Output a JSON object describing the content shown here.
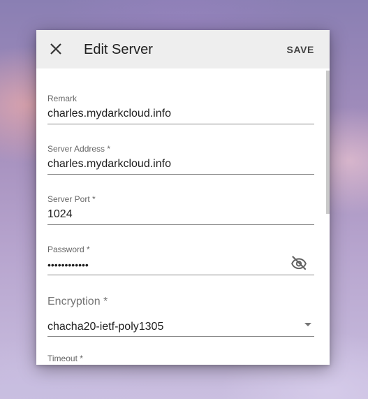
{
  "dialog": {
    "title": "Edit Server",
    "close_icon": "close-icon",
    "save_label": "SAVE"
  },
  "fields": {
    "remark": {
      "label": "Remark",
      "value": "charles.mydarkcloud.info"
    },
    "server_address": {
      "label": "Server Address *",
      "value": "charles.mydarkcloud.info"
    },
    "server_port": {
      "label": "Server Port *",
      "value": "1024"
    },
    "password": {
      "label": "Password *",
      "value": "••••••••••••",
      "toggle_icon": "visibility-off-icon"
    },
    "encryption": {
      "label": "Encryption *",
      "value": "chacha20-ietf-poly1305",
      "dropdown_icon": "arrow-drop-down-icon"
    },
    "timeout": {
      "label": "Timeout *"
    }
  },
  "colors": {
    "appbar_bg": "#eeeeee",
    "dialog_bg": "#ffffff",
    "text_primary": "#212121",
    "text_secondary": "#666666"
  }
}
